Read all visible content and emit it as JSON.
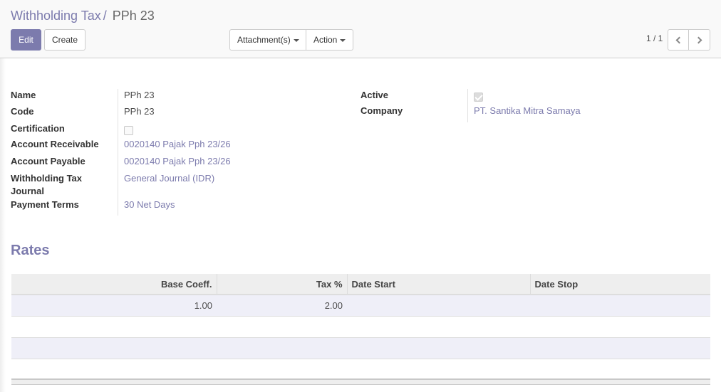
{
  "breadcrumb": {
    "parent": "Withholding Tax",
    "separator": "/",
    "current": "PPh 23"
  },
  "buttons": {
    "edit": "Edit",
    "create": "Create",
    "attachments": "Attachment(s)",
    "action": "Action"
  },
  "pager": {
    "value": "1 / 1",
    "prev_icon": "chevron-left-icon",
    "next_icon": "chevron-right-icon"
  },
  "form": {
    "left_fields": [
      {
        "label": "Name",
        "value": "PPh 23",
        "type": "text"
      },
      {
        "label": "Code",
        "value": "PPh 23",
        "type": "text"
      },
      {
        "label": "Certification",
        "value": false,
        "type": "checkbox"
      },
      {
        "label": "Account Receivable",
        "value": "0020140 Pajak Pph 23/26",
        "type": "link"
      },
      {
        "label": "Account Payable",
        "value": "0020140 Pajak Pph 23/26",
        "type": "link"
      },
      {
        "label": "Withholding Tax Journal",
        "value": "General Journal (IDR)",
        "type": "link"
      },
      {
        "label": "Payment Terms",
        "value": "30 Net Days",
        "type": "link"
      }
    ],
    "right_fields": [
      {
        "label": "Active",
        "value": true,
        "type": "checkbox"
      },
      {
        "label": "Company",
        "value": "PT. Santika Mitra Samaya",
        "type": "link"
      }
    ]
  },
  "rates": {
    "title": "Rates",
    "columns": [
      "Base Coeff.",
      "Tax %",
      "Date Start",
      "Date Stop"
    ],
    "rows": [
      {
        "base_coeff": "1.00",
        "tax_pct": "2.00",
        "date_start": "",
        "date_stop": ""
      }
    ]
  },
  "colors": {
    "accent": "#7c7bad",
    "row_highlight": "#efeff8",
    "header_bg": "#eeeeee"
  }
}
